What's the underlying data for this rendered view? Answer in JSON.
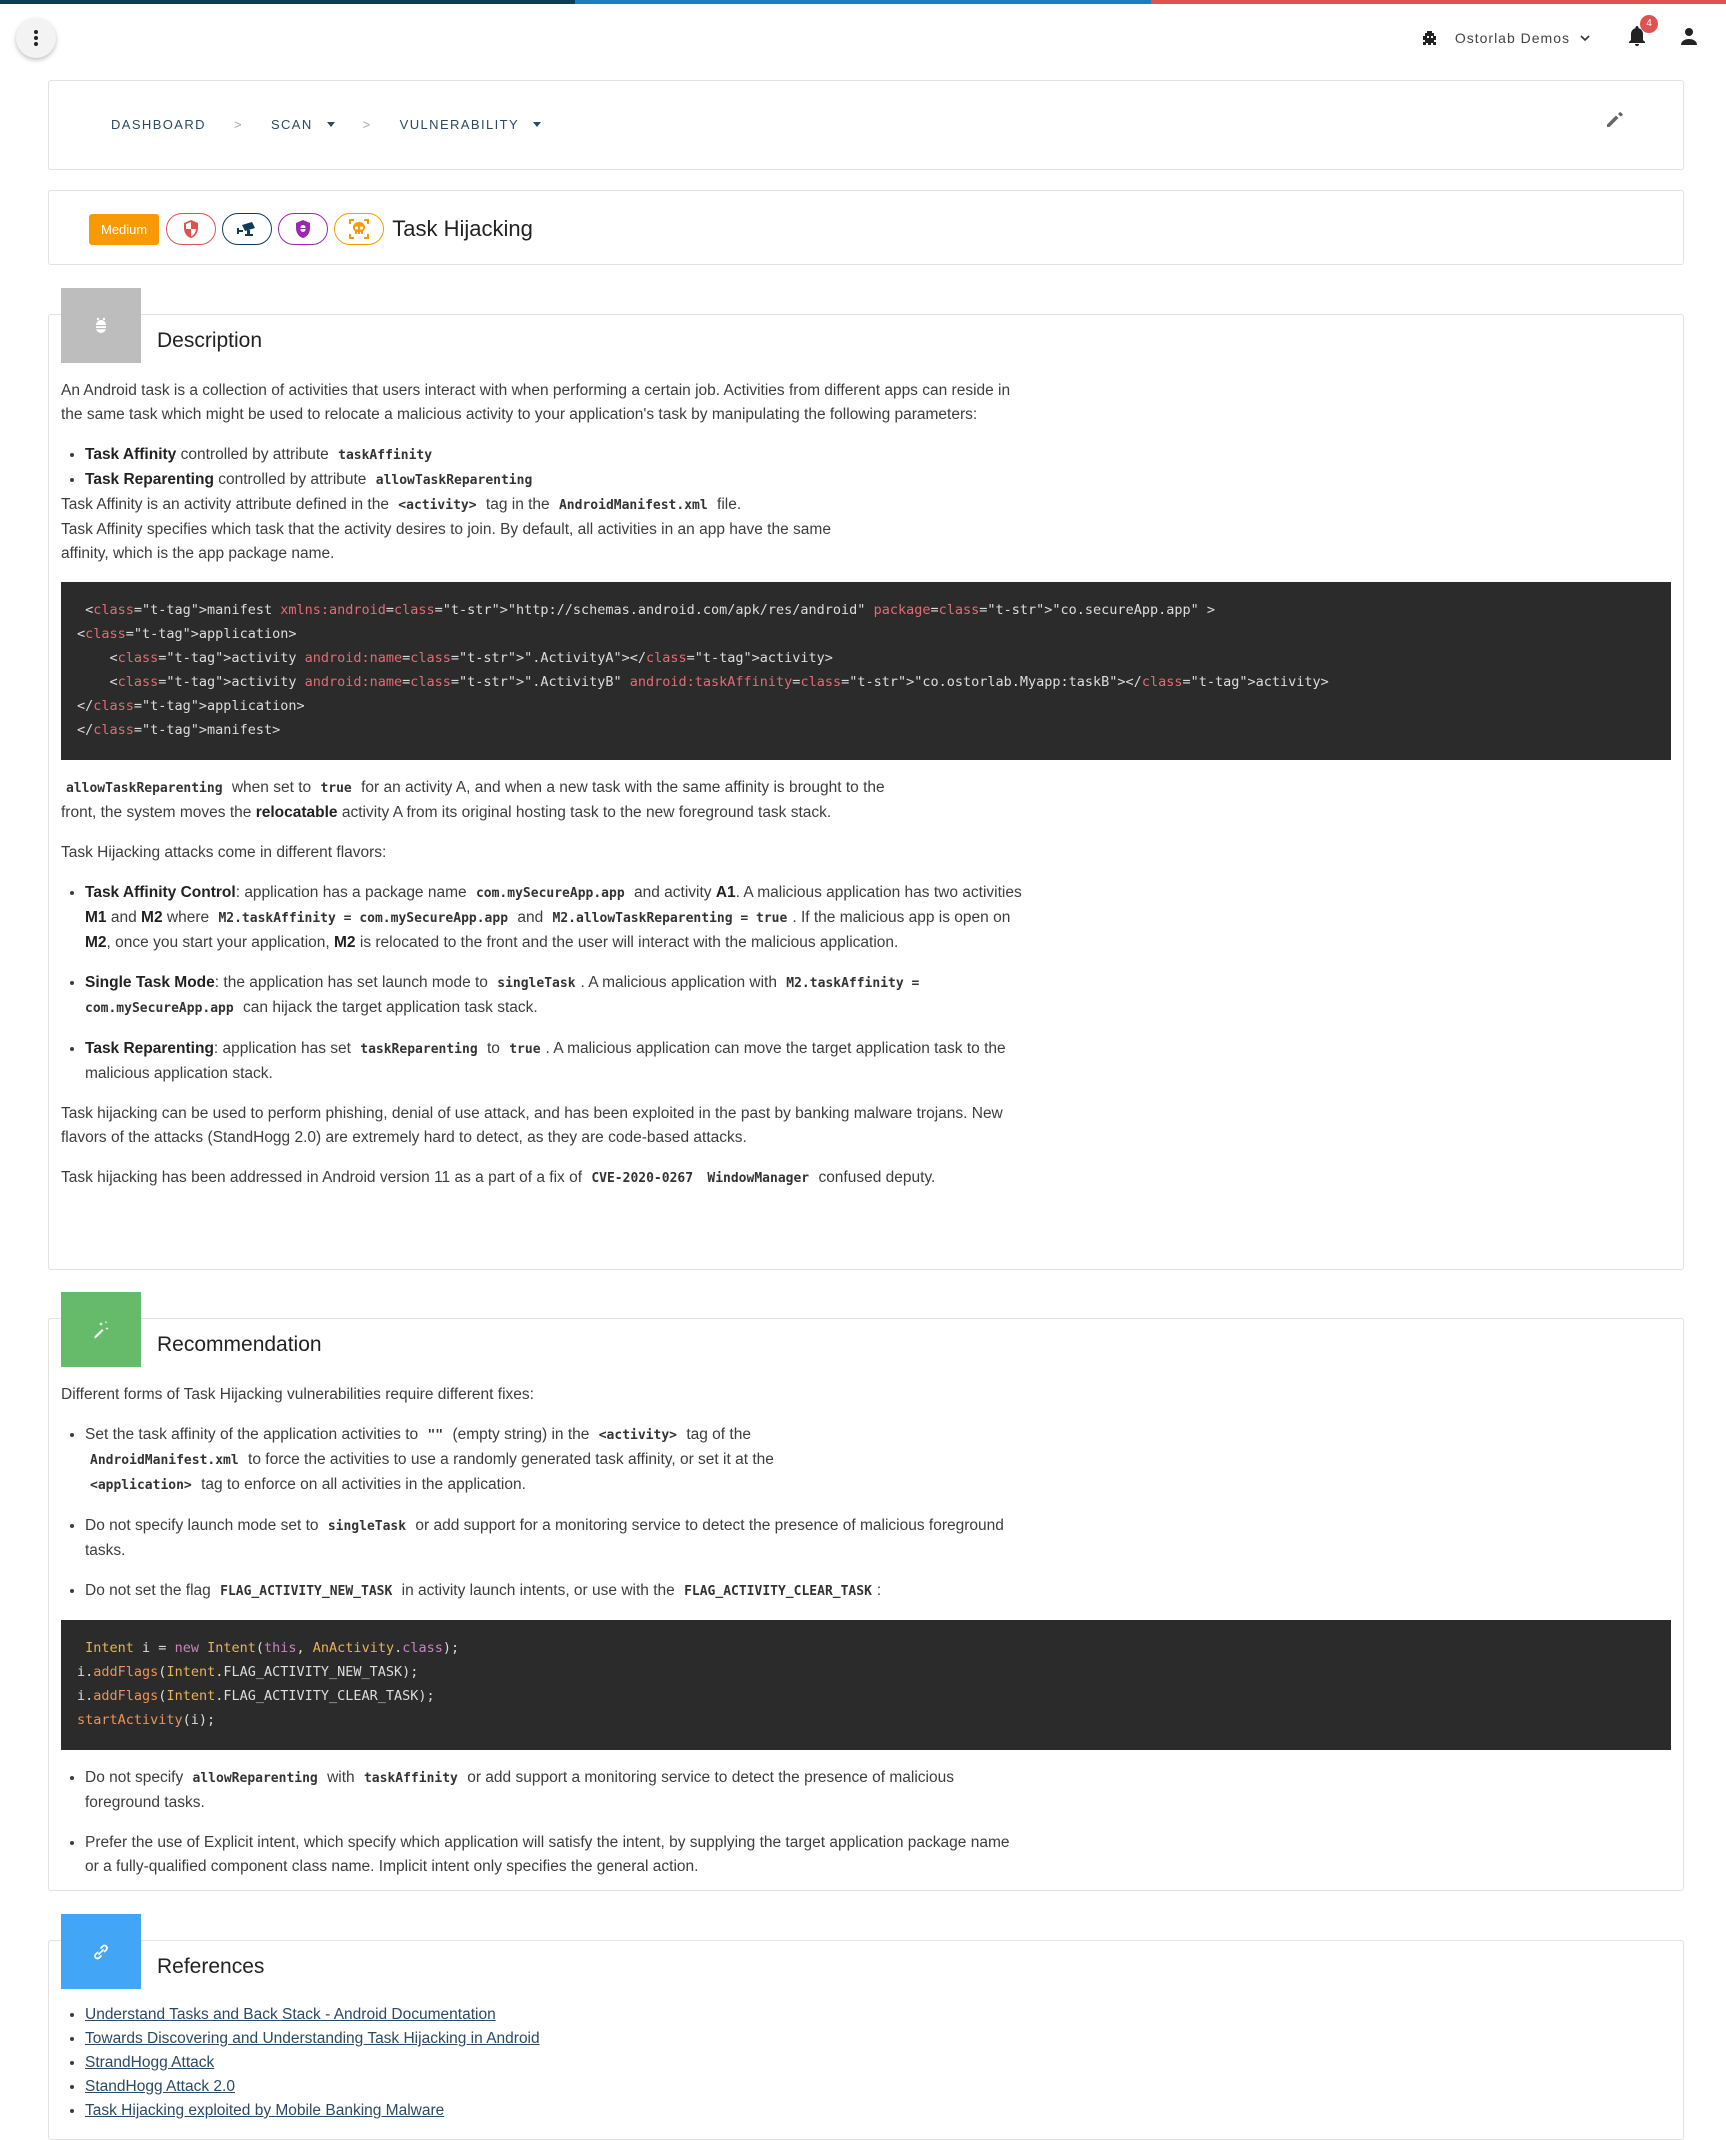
{
  "colors": {
    "topline": [
      "#0e3d5a",
      "#1a7fc1",
      "#e05252"
    ],
    "severity_medium": "#f89a05",
    "description_icon_bg": "#bdbdbd",
    "recommendation_icon_bg": "#66bb6a",
    "references_icon_bg": "#42a5f5",
    "link": "#2c4a63"
  },
  "topbar": {
    "org_name": "Ostorlab Demos",
    "notification_count": "4"
  },
  "breadcrumb": {
    "items": [
      {
        "label": "DASHBOARD",
        "dropdown": false
      },
      {
        "label": "SCAN",
        "dropdown": true
      },
      {
        "label": "VULNERABILITY",
        "dropdown": true
      }
    ],
    "separator": ">"
  },
  "vulnerability": {
    "severity": "Medium",
    "tags": [
      "security-shield",
      "surveillance-camera",
      "bug-shield",
      "skull-target"
    ],
    "title": "Task Hijacking"
  },
  "description": {
    "title": "Description",
    "intro": "An Android task is a collection of activities that users interact with when performing a certain job. Activities from different apps can reside in the same task which might be used to relocate a malicious activity to your application's task by manipulating the following parameters:",
    "params": [
      {
        "name": "Task Affinity",
        "text": "controlled by attribute",
        "code": "taskAffinity"
      },
      {
        "name": "Task Reparenting",
        "text": "controlled by attribute",
        "code": "allowTaskReparenting"
      }
    ],
    "affinity_def_1": "Task Affinity is an activity attribute defined in the",
    "affinity_def_code1": "<activity>",
    "affinity_def_2": "tag in the",
    "affinity_def_code2": "AndroidManifest.xml",
    "affinity_def_3": "file.",
    "affinity_default": "Task Affinity specifies which task that the activity desires to join. By default, all activities in an app have the same affinity, which is the app package name.",
    "code_lines": [
      "<manifest xmlns:android=\"http://schemas.android.com/apk/res/android\" package=\"co.secureApp.app\" >",
      "<application>",
      "    <activity android:name=\".ActivityA\"></activity>",
      "    <activity android:name=\".ActivityB\" android:taskAffinity=\"co.ostorlab.Myapp:taskB\"></activity>",
      "</application>",
      "</manifest>"
    ],
    "reparent_code": "allowTaskReparenting",
    "reparent_1": "when set to",
    "reparent_true": "true",
    "reparent_2": "for an activity A, and when a new task with the same affinity is brought to the front, the system moves the",
    "reparent_bold": "relocatable",
    "reparent_3": "activity A from its original hosting task to the new foreground task stack.",
    "flavors_intro": "Task Hijacking attacks come in different flavors:",
    "flavors": {
      "affinity_control": {
        "name": "Task Affinity Control",
        "t1": ": application has a package name",
        "c1": "com.mySecureApp.app",
        "t2": "and activity",
        "b1": "A1",
        "t3": ". A malicious application has two activities",
        "b2": "M1",
        "t4": "and",
        "b3": "M2",
        "t5": "where",
        "c2": "M2.taskAffinity = com.mySecureApp.app",
        "t6": "and",
        "c3": "M2.allowTaskReparenting = true",
        "t7": ". If the malicious app is open on",
        "b4": "M2",
        "t8": ", once you start your application,",
        "b5": "M2",
        "t9": "is relocated to the front and the user will interact with the malicious application."
      },
      "single_task": {
        "name": "Single Task Mode",
        "t1": ": the application has set launch mode to",
        "c1": "singleTask",
        "t2": ". A malicious application with",
        "c2": "M2.taskAffinity = com.mySecureApp.app",
        "t3": "can hijack the target application task stack."
      },
      "reparenting": {
        "name": "Task Reparenting",
        "t1": ": application has set",
        "c1": "taskReparenting",
        "t2": "to",
        "c2": "true",
        "t3": ". A malicious application can move the target application task to the malicious application stack."
      }
    },
    "usage": "Task hijacking can be used to perform phishing, denial of use attack, and has been exploited in the past by banking malware trojans. New flavors of the attacks (StandHogg 2.0) are extremely hard to detect, as they are code-based attacks.",
    "fix_1": "Task hijacking has been addressed in Android version 11 as a part of a fix of",
    "fix_code1": "CVE-2020-0267",
    "fix_code2": "WindowManager",
    "fix_2": "confused deputy."
  },
  "recommendation": {
    "title": "Recommendation",
    "intro": "Different forms of Task Hijacking vulnerabilities require different fixes:",
    "r1": {
      "t1": "Set the task affinity of the application activities to",
      "c1": "\"\"",
      "t2": "(empty string) in the",
      "c2": "<activity>",
      "t3": "tag of the",
      "c3": "AndroidManifest.xml",
      "t4": "to force the activities to use a randomly generated task affinity, or set it at the",
      "c4": "<application>",
      "t5": "tag to enforce on all activities in the application."
    },
    "r2": {
      "t1": "Do not specify launch mode set to",
      "c1": "singleTask",
      "t2": "or add support for a monitoring service to detect the presence of malicious foreground tasks."
    },
    "r3": {
      "t1": "Do not set the flag",
      "c1": "FLAG_ACTIVITY_NEW_TASK",
      "t2": "in activity launch intents, or use with the",
      "c2": "FLAG_ACTIVITY_CLEAR_TASK",
      "t3": ":"
    },
    "code_lines": [
      "Intent i = new Intent(this, AnActivity.class);",
      "i.addFlags(Intent.FLAG_ACTIVITY_NEW_TASK);",
      "i.addFlags(Intent.FLAG_ACTIVITY_CLEAR_TASK);",
      "startActivity(i);"
    ],
    "r4": {
      "t1": "Do not specify",
      "c1": "allowReparenting",
      "t2": "with",
      "c2": "taskAffinity",
      "t3": "or add support a monitoring service to detect the presence of malicious foreground tasks."
    },
    "r5": "Prefer the use of Explicit intent, which specify which application will satisfy the intent, by supplying the target application package name or a fully-qualified component class name. Implicit intent only specifies the general action."
  },
  "references": {
    "title": "References",
    "links": [
      "Understand Tasks and Back Stack - Android Documentation",
      "Towards Discovering and Understanding Task Hijacking in Android",
      "StrandHogg Attack",
      "StandHogg Attack 2.0",
      "Task Hijacking exploited by Mobile Banking Malware"
    ]
  }
}
